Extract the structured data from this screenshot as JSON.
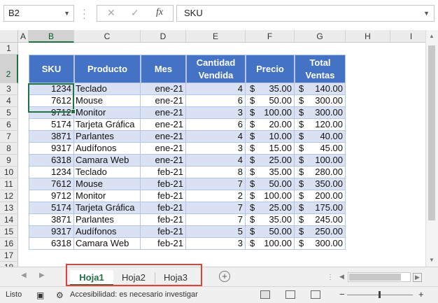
{
  "formula_bar": {
    "name_box": "B2",
    "cancel_glyph": "✕",
    "enter_glyph": "✓",
    "fx_glyph": "fx",
    "formula_value": "SKU"
  },
  "columns": [
    "A",
    "B",
    "C",
    "D",
    "E",
    "F",
    "G",
    "H",
    "I"
  ],
  "rows": [
    "1",
    "2",
    "3",
    "4",
    "5",
    "6",
    "7",
    "8",
    "9",
    "10",
    "11",
    "12",
    "13",
    "14",
    "15",
    "16",
    "17",
    "18"
  ],
  "table": {
    "headers": {
      "sku": "SKU",
      "producto": "Producto",
      "mes": "Mes",
      "cantidad_line1": "Cantidad",
      "cantidad_line2": "Vendida",
      "precio": "Precio",
      "total_line1": "Total",
      "total_line2": "Ventas"
    },
    "currency_symbol": "$",
    "rows": [
      {
        "sku": "1234",
        "producto": "Teclado",
        "mes": "ene-21",
        "cantidad": "4",
        "precio": "35.00",
        "total": "140.00"
      },
      {
        "sku": "7612",
        "producto": "Mouse",
        "mes": "ene-21",
        "cantidad": "6",
        "precio": "50.00",
        "total": "300.00"
      },
      {
        "sku": "9712",
        "producto": "Monitor",
        "mes": "ene-21",
        "cantidad": "3",
        "precio": "100.00",
        "total": "300.00"
      },
      {
        "sku": "5174",
        "producto": "Tarjeta Gráfica",
        "mes": "ene-21",
        "cantidad": "6",
        "precio": "20.00",
        "total": "120.00"
      },
      {
        "sku": "3871",
        "producto": "Parlantes",
        "mes": "ene-21",
        "cantidad": "4",
        "precio": "10.00",
        "total": "40.00"
      },
      {
        "sku": "9317",
        "producto": "Audífonos",
        "mes": "ene-21",
        "cantidad": "3",
        "precio": "15.00",
        "total": "45.00"
      },
      {
        "sku": "6318",
        "producto": "Camara Web",
        "mes": "ene-21",
        "cantidad": "4",
        "precio": "25.00",
        "total": "100.00"
      },
      {
        "sku": "1234",
        "producto": "Teclado",
        "mes": "feb-21",
        "cantidad": "8",
        "precio": "35.00",
        "total": "280.00"
      },
      {
        "sku": "7612",
        "producto": "Mouse",
        "mes": "feb-21",
        "cantidad": "7",
        "precio": "50.00",
        "total": "350.00"
      },
      {
        "sku": "9712",
        "producto": "Monitor",
        "mes": "feb-21",
        "cantidad": "2",
        "precio": "100.00",
        "total": "200.00"
      },
      {
        "sku": "5174",
        "producto": "Tarjeta Gráfica",
        "mes": "feb-21",
        "cantidad": "7",
        "precio": "25.00",
        "total": "175.00"
      },
      {
        "sku": "3871",
        "producto": "Parlantes",
        "mes": "feb-21",
        "cantidad": "7",
        "precio": "35.00",
        "total": "245.00"
      },
      {
        "sku": "9317",
        "producto": "Audífonos",
        "mes": "feb-21",
        "cantidad": "5",
        "precio": "50.00",
        "total": "250.00"
      },
      {
        "sku": "6318",
        "producto": "Camara Web",
        "mes": "feb-21",
        "cantidad": "3",
        "precio": "100.00",
        "total": "300.00"
      }
    ]
  },
  "sheet_tabs": {
    "tabs": [
      "Hoja1",
      "Hoja2",
      "Hoja3"
    ],
    "active": "Hoja1",
    "add_glyph": "+"
  },
  "status_bar": {
    "ready": "Listo",
    "accessibility": "Accesibilidad: es necesario investigar",
    "zoom_minus": "−",
    "zoom_plus": "+"
  },
  "colors": {
    "header_fill": "#4472c4",
    "band_fill": "#d9e1f2",
    "selection_green": "#217346",
    "highlight_red": "#e0413a"
  }
}
